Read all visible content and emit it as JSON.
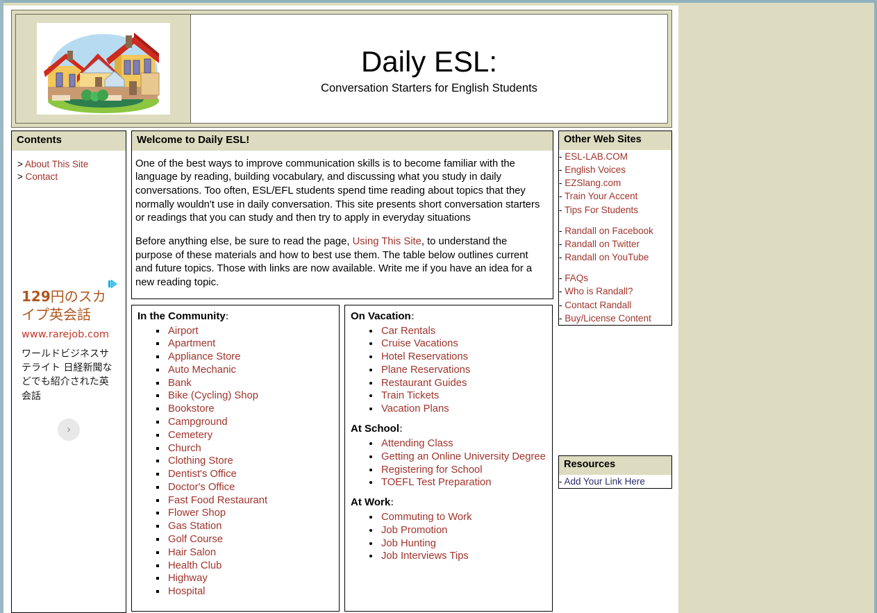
{
  "theme": {
    "page_bg": "#dddcc0",
    "link_red": "#a0342c",
    "link_navy": "#2c2c6e",
    "header_bar": "#dddcc0",
    "chrome_blue": "#8fb0bd"
  },
  "masthead": {
    "logo_alt": "house-clipart",
    "title": "Daily ESL:",
    "subtitle": "Conversation Starters for English Students"
  },
  "sidebar_left": {
    "heading": "Contents",
    "items": [
      {
        "prefix": ">",
        "label": "About This Site"
      },
      {
        "prefix": ">",
        "label": "Contact"
      }
    ],
    "ad": {
      "choices_icon": "adchoices-icon",
      "title": "129円のスカイプ英会話",
      "title_number": "129",
      "title_rest": "円のスカイプ英会話",
      "url": "www.rarejob.com",
      "description": "ワールドビジネスサテライト 日経新聞などでも紹介された英会話",
      "arrow_label": "›"
    }
  },
  "main": {
    "welcome": {
      "heading": "Welcome to Daily ESL!",
      "paragraph1": "One of the best ways to improve communication skills is to become familiar with the language by reading, building vocabulary, and discussing what you study in daily conversations. Too often, ESL/EFL students spend time reading about topics that they normally wouldn't use in daily conversation. This site presents short conversation starters or readings that you can study and then try to apply in everyday situations",
      "paragraph2_part1": "Before anything else, be sure to read the page, ",
      "paragraph2_link": "Using This Site",
      "paragraph2_part2": ", to understand the purpose of these materials and how to best use them. The table below outlines current and future topics. Those with links are now available. Write me if you have an idea for a new reading topic."
    },
    "topic_columns": [
      {
        "sections": [
          {
            "heading": "In the Community",
            "bullet": "square",
            "items": [
              "Airport",
              "Apartment",
              "Appliance Store",
              "Auto Mechanic",
              "Bank",
              "Bike (Cycling) Shop",
              "Bookstore",
              "Campground",
              "Cemetery",
              "Church",
              "Clothing Store",
              "Dentist's Office",
              "Doctor's Office",
              "Fast Food Restaurant",
              "Flower Shop",
              "Gas Station",
              "Golf Course",
              "Hair Salon",
              "Health Club",
              "Highway",
              "Hospital"
            ]
          }
        ]
      },
      {
        "sections": [
          {
            "heading": "On Vacation",
            "bullet": "disc",
            "items": [
              "Car Rentals",
              "Cruise Vacations",
              "Hotel Reservations",
              "Plane Reservations",
              "Restaurant Guides",
              "Train Tickets",
              "Vacation Plans"
            ]
          },
          {
            "heading": "At School",
            "bullet": "disc",
            "items": [
              "Attending Class",
              "Getting an Online University Degree",
              "Registering for School",
              "TOEFL Test Preparation"
            ]
          },
          {
            "heading": "At Work",
            "bullet": "disc",
            "items": [
              "Commuting to Work",
              "Job Promotion",
              "Job Hunting",
              "Job Interviews Tips"
            ]
          }
        ]
      }
    ]
  },
  "sidebar_right": {
    "other_sites": {
      "heading": "Other Web Sites",
      "groups": [
        [
          "ESL-LAB.COM",
          "English Voices",
          "EZSlang.com",
          "Train Your Accent",
          "Tips For Students"
        ],
        [
          "Randall on Facebook",
          "Randall on Twitter",
          "Randall on YouTube"
        ],
        [
          "FAQs",
          "Who is Randall?",
          "Contact Randall",
          "Buy/License Content"
        ]
      ]
    },
    "resources": {
      "heading": "Resources",
      "items": [
        "Add Your Link Here"
      ]
    }
  }
}
